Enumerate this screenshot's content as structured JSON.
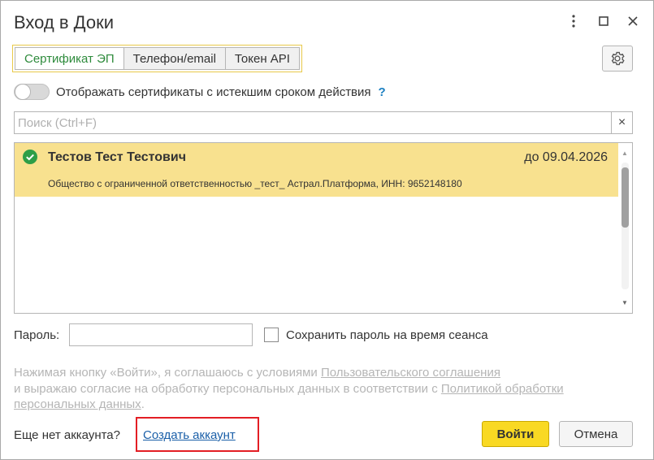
{
  "window": {
    "title": "Вход в Доки"
  },
  "tabs": [
    {
      "label": "Сертификат ЭП",
      "active": true
    },
    {
      "label": "Телефон/email",
      "active": false
    },
    {
      "label": "Токен API",
      "active": false
    }
  ],
  "toggle": {
    "label": "Отображать сертификаты с истекшим сроком действия",
    "enabled": false,
    "help_label": "?"
  },
  "search": {
    "placeholder": "Поиск (Ctrl+F)",
    "value": "",
    "clear_label": "×"
  },
  "certificates": [
    {
      "name": "Тестов Тест Тестович",
      "valid_until": "до 09.04.2026",
      "organization": "Общество с ограниченной ответственностью _тест_ Астрал.Платформа, ИНН: 9652148180",
      "valid": true,
      "selected": true
    }
  ],
  "password": {
    "label": "Пароль:",
    "value": ""
  },
  "save_password": {
    "label": "Сохранить пароль на время сеанса",
    "checked": false
  },
  "agreement": {
    "text_1": "Нажимая кнопку «Войти», я соглашаюсь с условиями ",
    "link_1": "Пользовательского соглашения",
    "text_2": "и выражаю согласие на обработку персональных данных в соответствии с ",
    "link_2": "Политикой обработки персональных данных",
    "text_3": "."
  },
  "account": {
    "no_account_text": "Еще нет аккаунта?",
    "create_link": "Создать аккаунт"
  },
  "buttons": {
    "login": "Войти",
    "cancel": "Отмена"
  },
  "colors": {
    "accent_yellow": "#f9d923",
    "selected_row": "#f8e18f",
    "active_tab_text": "#2e8b3c",
    "link": "#1a5fa8",
    "highlight_box": "#e31e24"
  }
}
